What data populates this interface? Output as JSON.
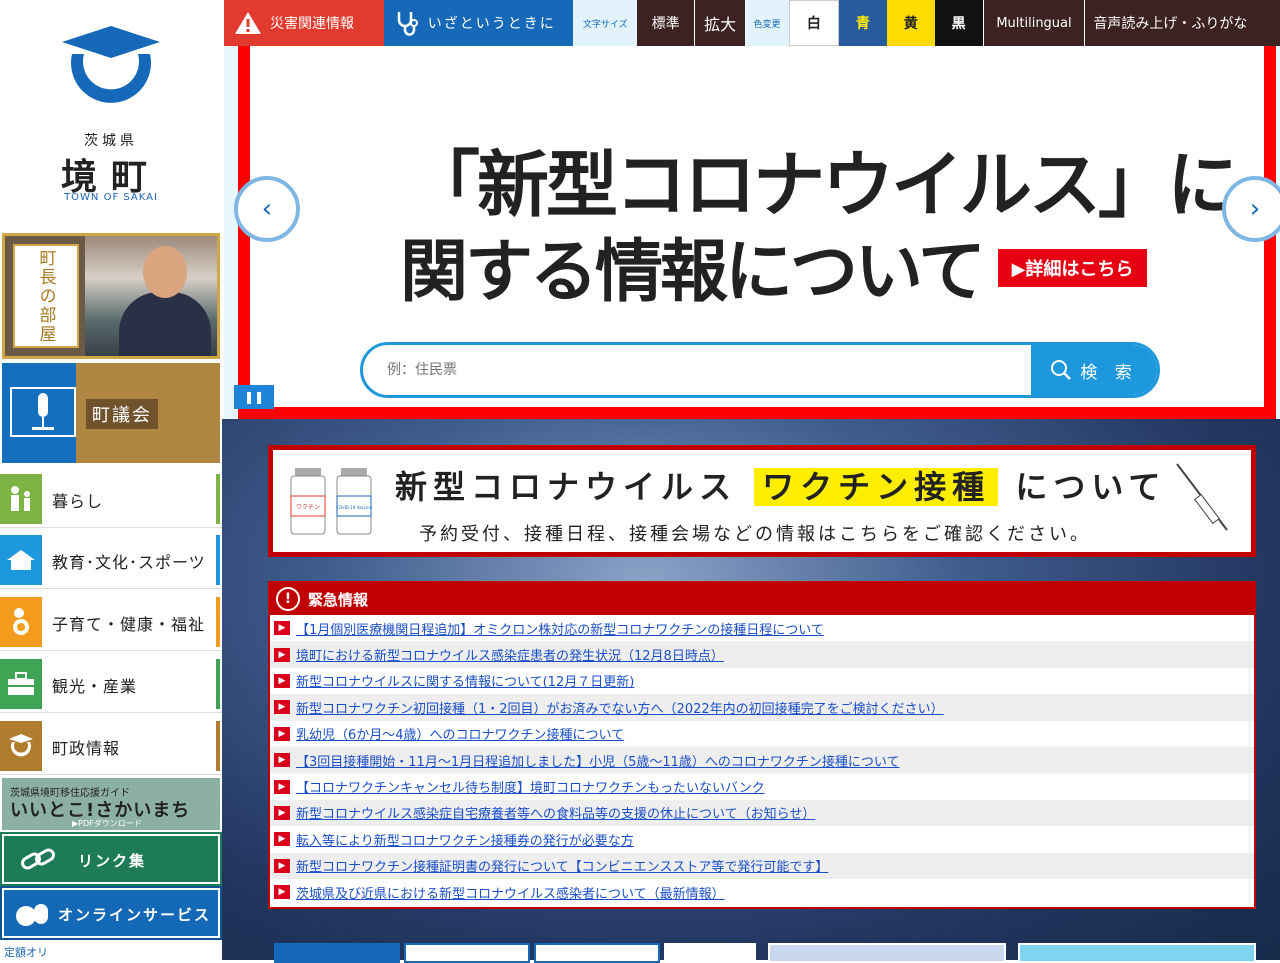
{
  "logo": {
    "pref": "茨城県",
    "town": "境町",
    "en": "TOWN OF SAKAI"
  },
  "topbar": {
    "disaster": "災害関連情報",
    "emergency": "いざというときに",
    "fontsize_label": "文字サイズ",
    "standard": "標準",
    "enlarge": "拡大",
    "color_label": "色変更",
    "white": "白",
    "blue": "青",
    "yellow": "黄",
    "black": "黒",
    "multilingual": "Multilingual",
    "voice": "音声読み上げ・ふりがな"
  },
  "sidebar": {
    "mayor": "町長の部屋",
    "council": "町議会",
    "items": [
      {
        "label": "暮らし",
        "color": "#7cb342"
      },
      {
        "label": "教育･文化･スポーツ",
        "color": "#1e98dc"
      },
      {
        "label": "子育て・健康・福祉",
        "color": "#f29b1d"
      },
      {
        "label": "観光・産業",
        "color": "#3fa554"
      },
      {
        "label": "町政情報",
        "color": "#b07d2e"
      }
    ],
    "iju": {
      "t1": "茨城県境町移住応援ガイド",
      "t2": "いいとこ!さかいまち",
      "t3": "▶PDFダウンロード"
    },
    "links": "リンク集",
    "online": "オンラインサービス",
    "bottom": "定額オリ"
  },
  "slider": {
    "headline1": "「新型コロナウイルス」に",
    "headline2": "関する情報について",
    "detail": "▶詳細はこちら"
  },
  "search": {
    "placeholder": "例：住民票",
    "button": "検 索"
  },
  "vaccine": {
    "line1_a": "新型コロナウイルス",
    "line1_hl": "ワクチン接種",
    "line1_b": "について",
    "line2": "予約受付、接種日程、接種会場などの情報はこちらをご確認ください。",
    "vial1": "ワクチン",
    "vial2": "COVID-19 Vaccine"
  },
  "urgent": {
    "title": "緊急情報",
    "items": [
      "【1月個別医療機関日程追加】オミクロン株対応の新型コロナワクチンの接種日程について",
      "境町における新型コロナウイルス感染症患者の発生状況（12月8日時点）",
      "新型コロナウイルスに関する情報について(12月７日更新)",
      "新型コロナワクチン初回接種（1・2回目）がお済みでない方へ（2022年内の初回接種完了をご検討ください）",
      "乳幼児（6か月〜4歳）へのコロナワクチン接種について",
      "【3回目接種開始・11月～1月日程追加しました】小児（5歳〜11歳）へのコロナワクチン接種について",
      "【コロナワクチンキャンセル待ち制度】境町コロナワクチンもったいないバンク",
      "新型コロナウイルス感染症自宅療養者等への食料品等の支援の休止について（お知らせ）",
      "転入等により新型コロナワクチン接種券の発行が必要な方",
      "新型コロナワクチン接種証明書の発行について【コンビニエンスストア等で発行可能です】",
      "茨城県及び近県における新型コロナウイルス感染者について（最新情報）"
    ]
  }
}
